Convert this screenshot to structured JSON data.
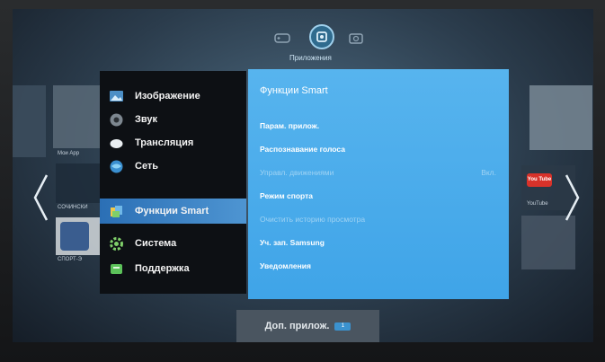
{
  "header": {
    "category_label": "Приложения",
    "icons": [
      "gamepad-icon",
      "apps-icon",
      "camera-icon"
    ]
  },
  "background_labels": {
    "my_apps": "Мои App",
    "sochinsk": "СОЧИНСКИ",
    "sport": "СПОРТ-Э",
    "youtube_left": "You Tube",
    "youtube_right": "YouTube"
  },
  "main_menu": {
    "items": [
      {
        "label": "Изображение",
        "icon": "picture-icon"
      },
      {
        "label": "Звук",
        "icon": "sound-icon"
      },
      {
        "label": "Трансляция",
        "icon": "broadcast-icon"
      },
      {
        "label": "Сеть",
        "icon": "network-icon"
      },
      {
        "label": "Функции Smart",
        "icon": "smart-features-icon",
        "selected": true
      },
      {
        "label": "Система",
        "icon": "system-gear-icon"
      },
      {
        "label": "Поддержка",
        "icon": "support-icon"
      }
    ]
  },
  "submenu": {
    "title": "Функции Smart",
    "items": [
      {
        "label": "Парам. прилож.",
        "enabled": true
      },
      {
        "label": "Распознавание голоса",
        "enabled": true
      },
      {
        "label": "Управл. движениями",
        "enabled": false,
        "value": "Вкл."
      },
      {
        "label": "Режим спорта",
        "enabled": true
      },
      {
        "label": "Очистить историю просмотра",
        "enabled": false
      },
      {
        "label": "Уч. зап. Samsung",
        "enabled": true
      },
      {
        "label": "Уведомления",
        "enabled": true
      }
    ]
  },
  "footer": {
    "more_apps_label": "Доп. прилож.",
    "badge": "1"
  },
  "colors": {
    "selected_item": "#3a86c8",
    "submenu_bg": "#4aaced",
    "menu_bg": "#0d1014"
  }
}
